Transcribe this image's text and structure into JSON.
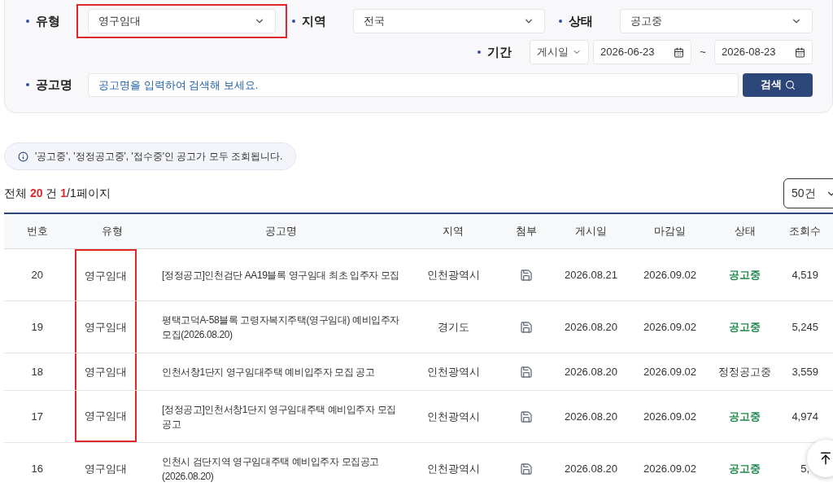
{
  "filters": {
    "type": {
      "label": "유형",
      "value": "영구임대",
      "highlighted": true
    },
    "region": {
      "label": "지역",
      "value": "전국",
      "highlighted": false
    },
    "status": {
      "label": "상태",
      "value": "공고중",
      "highlighted": false
    },
    "period": {
      "label": "기간",
      "basis": "게시일",
      "from": "2026-06-23",
      "separator": "~",
      "to": "2026-08-23"
    },
    "name": {
      "label": "공고명",
      "placeholder": "공고명을 입력하여 검색해 보세요."
    },
    "search_button": "검색"
  },
  "notice": "'공고중', '정정공고중', '접수중'인 공고가 모두 조회됩니다.",
  "summary": {
    "prefix": "전체",
    "total": "20",
    "unit": "건",
    "page": "1",
    "pages": "/1페이지"
  },
  "page_size": "50건",
  "table": {
    "columns": [
      "번호",
      "유형",
      "공고명",
      "지역",
      "첨부",
      "게시일",
      "마감일",
      "상태",
      "조회수"
    ],
    "rows": [
      {
        "no": "20",
        "type": "영구임대",
        "title": "[정정공고]인천검단 AA19블록 영구임대 최초 입주자 모집",
        "region": "인천광역시",
        "posted": "2026.08.21",
        "deadline": "2026.09.02",
        "status": "공고중",
        "emphasized": true,
        "views": "4,519",
        "highlighted": true
      },
      {
        "no": "19",
        "type": "영구임대",
        "title": "평택고덕A-58블록 고령자복지주택(영구임대) 예비입주자 모집(2026.08.20)",
        "region": "경기도",
        "posted": "2026.08.20",
        "deadline": "2026.09.02",
        "status": "공고중",
        "emphasized": true,
        "views": "5,245",
        "highlighted": true
      },
      {
        "no": "18",
        "type": "영구임대",
        "title": "인천서창1단지 영구임대주택 예비입주자 모집 공고",
        "region": "인천광역시",
        "posted": "2026.08.20",
        "deadline": "2026.09.02",
        "status": "정정공고중",
        "emphasized": false,
        "views": "3,559",
        "highlighted": true
      },
      {
        "no": "17",
        "type": "영구임대",
        "title": "[정정공고]인천서창1단지 영구임대주택 예비입주자 모집 공고",
        "region": "인천광역시",
        "posted": "2026.08.20",
        "deadline": "2026.09.02",
        "status": "공고중",
        "emphasized": true,
        "views": "4,974",
        "highlighted": true
      },
      {
        "no": "16",
        "type": "영구임대",
        "title": "인천시 검단지역 영구임대주택 예비입주자 모집공고 (2026.08.20)",
        "region": "인천광역시",
        "posted": "2026.08.20",
        "deadline": "2026.09.02",
        "status": "공고중",
        "emphasized": true,
        "views": "5,",
        "highlighted": false
      }
    ]
  }
}
